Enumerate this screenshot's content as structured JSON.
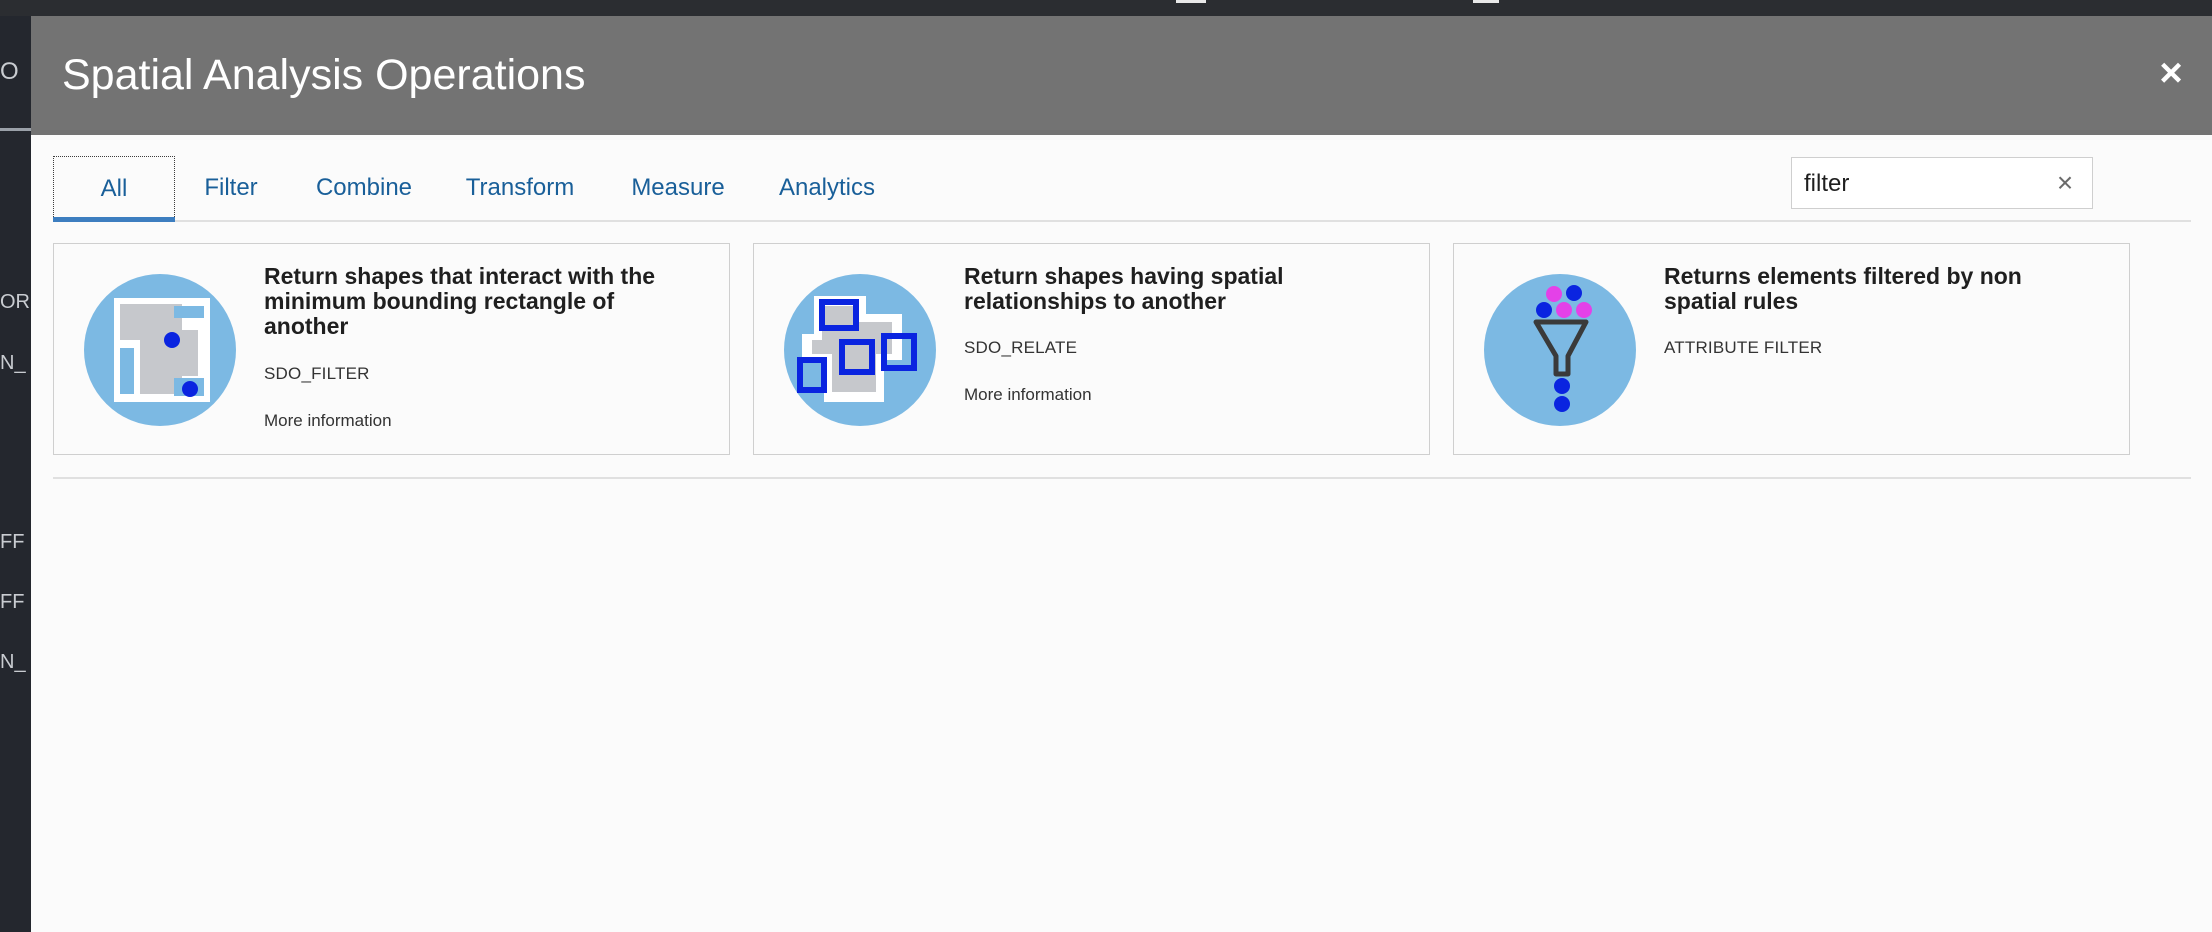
{
  "background_app": {
    "left_fragments": [
      "O",
      "OR",
      "N_",
      "FF",
      "FF",
      "N_"
    ]
  },
  "dialog": {
    "title": "Spatial Analysis Operations",
    "close_glyph": "×"
  },
  "tabs": [
    {
      "label": "All",
      "active": true
    },
    {
      "label": "Filter",
      "active": false
    },
    {
      "label": "Combine",
      "active": false
    },
    {
      "label": "Transform",
      "active": false
    },
    {
      "label": "Measure",
      "active": false
    },
    {
      "label": "Analytics",
      "active": false
    }
  ],
  "search": {
    "value": "filter",
    "clear_glyph": "×"
  },
  "cards": [
    {
      "title": "Return shapes that interact with the minimum bounding rectangle of another",
      "code": "SDO_FILTER",
      "more": "More information",
      "icon": "mbr-filter-icon"
    },
    {
      "title": "Return shapes having spatial relationships to another",
      "code": "SDO_RELATE",
      "more": "More information",
      "icon": "spatial-relate-icon"
    },
    {
      "title": "Returns elements filtered by non spatial rules",
      "code": "ATTRIBUTE FILTER",
      "more": "",
      "icon": "funnel-icon"
    }
  ],
  "colors": {
    "header": "#737373",
    "tab_text": "#195f99",
    "active_underline": "#3d7ec0",
    "icon_circle": "#7cb9e3",
    "icon_blue": "#0a24e0",
    "icon_magenta": "#e441e8"
  }
}
